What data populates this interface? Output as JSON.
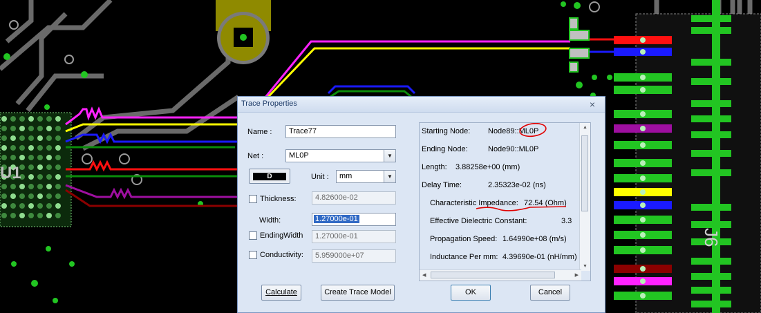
{
  "dialog": {
    "title": "Trace Properties",
    "close_glyph": "×",
    "name_label": "Name :",
    "name_value": "Trace77",
    "net_label": "Net :",
    "net_value": "ML0P",
    "color_button_label": "D",
    "unit_label": "Unit :",
    "unit_value": "mm",
    "thickness_label": "Thickness:",
    "thickness_value": "4.82600e-02",
    "width_label": "Width:",
    "width_value": "1.27000e-01",
    "ending_width_label": "EndingWidth",
    "ending_width_value": "1.27000e-01",
    "conductivity_label": "Conductivity:",
    "conductivity_value": "5.959000e+07",
    "calculate_label": "Calculate",
    "create_model_label": "Create Trace Model",
    "ok_label": "OK",
    "cancel_label": "Cancel",
    "combo_arrow": "▼"
  },
  "info": {
    "starting_node_label": "Starting Node:",
    "starting_node_value": "Node89::ML0P",
    "ending_node_label": "Ending Node:",
    "ending_node_value": "Node90::ML0P",
    "length_label": "Length:",
    "length_value": "3.88258e+00 (mm)",
    "delay_label": "Delay Time:",
    "delay_value": "2.35323e-02 (ns)",
    "impedance_label": "Characteristic Impedance:",
    "impedance_value": "72.54 (Ohm)",
    "dielectric_label": "Effective Dielectric Constant:",
    "dielectric_value": "3.3",
    "speed_label": "Propagation Speed:",
    "speed_value": "1.64990e+08 (m/s)",
    "inductance_label": "Inductance Per mm:",
    "inductance_value": "4.39690e-01 (nH/mm)"
  },
  "board": {
    "u1_label": "U1",
    "j6_label": "J6",
    "colors": {
      "background": "#000000",
      "magenta": "#ff22ff",
      "yellow": "#ffff00",
      "blue": "#1a1aff",
      "green": "#0a8c0a",
      "red": "#ff1010",
      "purple": "#9e0fa0",
      "darkred": "#8b0000",
      "pad": "#22c522",
      "gray": "#6a6a6a",
      "olive": "#8f8a00",
      "annotation": "#e00000"
    }
  }
}
